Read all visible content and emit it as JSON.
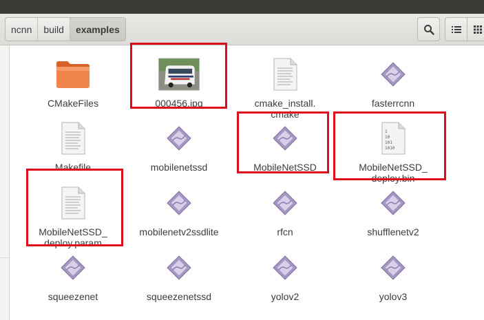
{
  "breadcrumb": [
    "ncnn",
    "build",
    "examples"
  ],
  "toolbar": {
    "search_icon": "search-icon",
    "list_icon": "list-view-icon",
    "grid_icon": "grid-view-icon"
  },
  "files": [
    {
      "name": "CMakeFiles",
      "type": "folder",
      "icon": "folder-icon"
    },
    {
      "name": "000456.jpg",
      "type": "image",
      "icon": "image-thumbnail"
    },
    {
      "name": "cmake_install.\ncmake",
      "type": "text",
      "icon": "text-file-icon"
    },
    {
      "name": "fasterrcnn",
      "type": "executable",
      "icon": "executable-icon"
    },
    {
      "name": "Makefile",
      "type": "text",
      "icon": "text-file-icon"
    },
    {
      "name": "mobilenetssd",
      "type": "executable",
      "icon": "executable-icon"
    },
    {
      "name": "MobileNetSSD",
      "type": "executable",
      "icon": "executable-icon"
    },
    {
      "name": "MobileNetSSD_\ndeploy.bin",
      "type": "binary",
      "icon": "binary-file-icon"
    },
    {
      "name": "MobileNetSSD_\ndeploy.param",
      "type": "text",
      "icon": "text-file-icon"
    },
    {
      "name": "mobilenetv2ssdlite",
      "type": "executable",
      "icon": "executable-icon"
    },
    {
      "name": "rfcn",
      "type": "executable",
      "icon": "executable-icon"
    },
    {
      "name": "shufflenetv2",
      "type": "executable",
      "icon": "executable-icon"
    },
    {
      "name": "squeezenet",
      "type": "executable",
      "icon": "executable-icon"
    },
    {
      "name": "squeezenetssd",
      "type": "executable",
      "icon": "executable-icon"
    },
    {
      "name": "yolov2",
      "type": "executable",
      "icon": "executable-icon"
    },
    {
      "name": "yolov3",
      "type": "executable",
      "icon": "executable-icon"
    }
  ],
  "binary_icon_text": [
    "1",
    "10",
    "101",
    "1010"
  ],
  "highlight_color": "#dd0d1c"
}
